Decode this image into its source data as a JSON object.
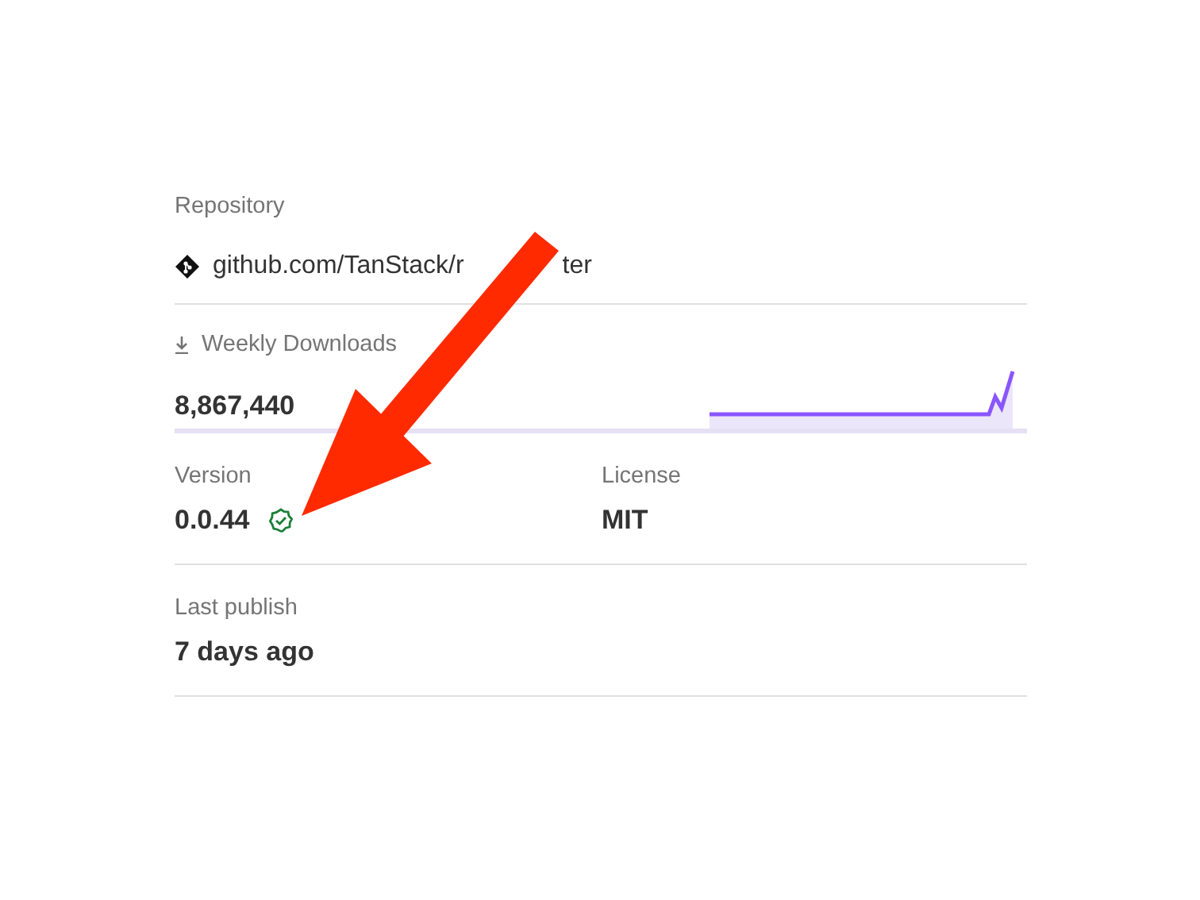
{
  "repository": {
    "label": "Repository",
    "link_parts": [
      "github.com/TanStack/r",
      "ter"
    ]
  },
  "weekly_downloads": {
    "label": "Weekly Downloads",
    "count": "8,867,440"
  },
  "version": {
    "label": "Version",
    "value": "0.0.44",
    "verified": true
  },
  "license": {
    "label": "License",
    "value": "MIT"
  },
  "last_publish": {
    "label": "Last publish",
    "value": "7 days ago"
  }
}
